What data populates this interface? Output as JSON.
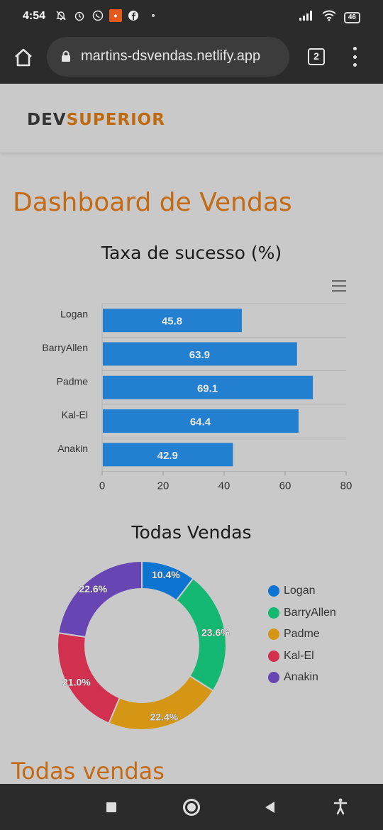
{
  "status_bar": {
    "time": "4:54",
    "icons_left": [
      "muted-bell-icon",
      "alarm-icon",
      "whatsapp-icon",
      "app-notification-icon",
      "facebook-icon"
    ],
    "battery": "46"
  },
  "browser": {
    "url": "martins-dsvendas.netlify.app",
    "tab_count": "2"
  },
  "header": {
    "logo_part1": "DEV",
    "logo_part2": "SUPERIOR"
  },
  "page": {
    "title": "Dashboard de Vendas",
    "section_title": "Todas vendas"
  },
  "colors": {
    "accent": "#c56a14",
    "bar": "#2380d0"
  },
  "bar_chart": {
    "title": "Taxa de sucesso (%)"
  },
  "donut_chart": {
    "title": "Todas Vendas"
  },
  "chart_data": [
    {
      "type": "bar",
      "orientation": "horizontal",
      "title": "Taxa de sucesso (%)",
      "categories": [
        "Logan",
        "BarryAllen",
        "Padme",
        "Kal-El",
        "Anakin"
      ],
      "values": [
        45.8,
        63.9,
        69.1,
        64.4,
        42.9
      ],
      "xlim": [
        0,
        80
      ],
      "xticks": [
        0,
        20,
        40,
        60,
        80
      ],
      "grid": true,
      "data_labels": true,
      "color": "#2380d0"
    },
    {
      "type": "pie",
      "variant": "donut",
      "title": "Todas Vendas",
      "labels": [
        "Logan",
        "BarryAllen",
        "Padme",
        "Kal-El",
        "Anakin"
      ],
      "values": [
        10.4,
        23.6,
        22.4,
        21.0,
        22.6
      ],
      "value_labels": [
        "10.4%",
        "23.6%",
        "22.4%",
        "21.0%",
        "22.6%"
      ],
      "colors": [
        "#0d74d1",
        "#14b873",
        "#d49614",
        "#d1314f",
        "#6745b3"
      ],
      "legend": "right"
    }
  ]
}
